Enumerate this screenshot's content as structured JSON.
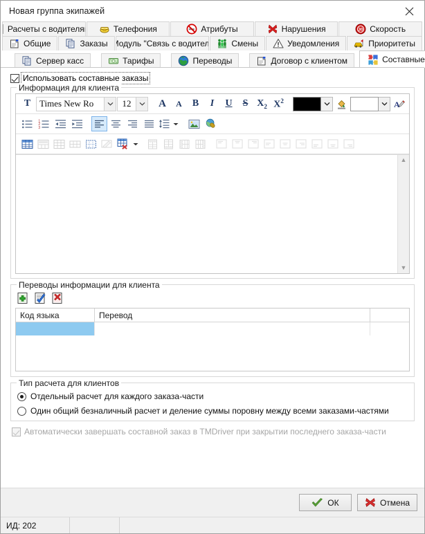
{
  "window": {
    "title": "Новая группа экипажей",
    "close_icon": "close-icon"
  },
  "tabs": {
    "row1": [
      {
        "label": "Расчеты с водителями",
        "icon": "calculator-icon"
      },
      {
        "label": "Телефония",
        "icon": "phone-icon"
      },
      {
        "label": "Атрибуты",
        "icon": "no-smoking-icon"
      },
      {
        "label": "Нарушения",
        "icon": "red-x-icon"
      },
      {
        "label": "Скорость",
        "icon": "speed-limit-icon"
      }
    ],
    "row2": [
      {
        "label": "Общие",
        "icon": "document-icon"
      },
      {
        "label": "Заказы",
        "icon": "copy-icon"
      },
      {
        "label": "Модуль \"Связь с водителями\"",
        "icon": "radio-icon"
      },
      {
        "label": "Смены",
        "icon": "people-icon"
      },
      {
        "label": "Уведомления",
        "icon": "warning-icon"
      },
      {
        "label": "Приоритеты",
        "icon": "taxi-icon"
      }
    ],
    "row3": [
      {
        "label": "Сервер касс",
        "icon": "copy-icon"
      },
      {
        "label": "Тарифы",
        "icon": "money-icon"
      },
      {
        "label": "Переводы",
        "icon": "globe-icon"
      },
      {
        "label": "Договор с клиентом",
        "icon": "document-icon"
      },
      {
        "label": "Составные заказы",
        "icon": "puzzle-icon",
        "active": true
      }
    ]
  },
  "main": {
    "use_composite_orders": {
      "label": "Использовать составные заказы",
      "checked": true
    },
    "client_info": {
      "legend": "Информация для клиента",
      "font_name": "Times New Ro",
      "font_size": "12",
      "text_color": "#000000",
      "highlight_color": "#ffffff",
      "content": "",
      "toolbar_row1": [
        {
          "name": "font-dialog-icon",
          "label": "T"
        },
        {
          "name": "grow-font-icon",
          "label": "A"
        },
        {
          "name": "shrink-font-icon",
          "label": "A"
        },
        {
          "name": "bold-icon",
          "label": "B"
        },
        {
          "name": "italic-icon",
          "label": "I"
        },
        {
          "name": "underline-icon",
          "label": "U"
        },
        {
          "name": "strikethrough-icon",
          "label": "S"
        },
        {
          "name": "subscript-icon",
          "label": "X₂"
        },
        {
          "name": "superscript-icon",
          "label": "X²"
        },
        {
          "name": "fill-color-icon",
          "label": ""
        },
        {
          "name": "text-highlight-icon",
          "label": "A"
        }
      ],
      "toolbar_row2": [
        {
          "name": "bullet-list-icon"
        },
        {
          "name": "numbered-list-icon"
        },
        {
          "name": "decrease-indent-icon"
        },
        {
          "name": "increase-indent-icon"
        },
        {
          "name": "align-left-icon",
          "selected": true
        },
        {
          "name": "align-center-icon"
        },
        {
          "name": "align-right-icon"
        },
        {
          "name": "align-justify-icon"
        },
        {
          "name": "line-spacing-icon"
        },
        {
          "name": "insert-image-icon"
        },
        {
          "name": "insert-hyperlink-icon"
        }
      ],
      "toolbar_row3": [
        {
          "name": "insert-table-icon",
          "dim": false
        },
        {
          "name": "merge-cells-icon",
          "dim": true
        },
        {
          "name": "split-cells-icon",
          "dim": true
        },
        {
          "name": "table-grid-icon",
          "dim": true
        },
        {
          "name": "table-borders-icon",
          "dim": false
        },
        {
          "name": "table-properties-icon",
          "dim": true
        },
        {
          "name": "delete-table-icon",
          "dim": false
        },
        {
          "name": "insert-row-above-icon",
          "dim": true
        },
        {
          "name": "insert-row-below-icon",
          "dim": true
        },
        {
          "name": "insert-column-left-icon",
          "dim": true
        },
        {
          "name": "insert-column-right-icon",
          "dim": true
        },
        {
          "name": "cell-align-top-left-icon",
          "dim": true
        },
        {
          "name": "cell-align-top-center-icon",
          "dim": true
        },
        {
          "name": "cell-align-top-right-icon",
          "dim": true
        },
        {
          "name": "cell-align-middle-left-icon",
          "dim": true
        },
        {
          "name": "cell-align-middle-center-icon",
          "dim": true
        },
        {
          "name": "cell-align-middle-right-icon",
          "dim": true
        },
        {
          "name": "cell-align-bottom-left-icon",
          "dim": true
        },
        {
          "name": "cell-align-bottom-center-icon",
          "dim": true
        },
        {
          "name": "cell-align-bottom-right-icon",
          "dim": true
        }
      ]
    },
    "translations": {
      "legend": "Переводы информации для клиента",
      "buttons": [
        {
          "name": "add-translation-button",
          "icon": "add-green-icon"
        },
        {
          "name": "edit-translation-button",
          "icon": "edit-check-icon"
        },
        {
          "name": "delete-translation-button",
          "icon": "delete-red-icon"
        }
      ],
      "columns": [
        "Код языка",
        "Перевод"
      ],
      "rows": [
        {
          "lang_code": "",
          "translation": "",
          "selected": true
        }
      ]
    },
    "calc_type": {
      "legend": "Тип расчета для клиентов",
      "options": [
        {
          "label": "Отдельный расчет для каждого заказа-части",
          "selected": true
        },
        {
          "label": "Один общий безналичный расчет и деление суммы поровну между всеми заказами-частями",
          "selected": false
        }
      ]
    },
    "auto_finish": {
      "label": "Автоматически завершать составной заказ в TMDriver при закрытии последнего заказа-части",
      "checked": true,
      "disabled": true
    }
  },
  "footer": {
    "ok_label": "ОК",
    "cancel_label": "Отмена"
  },
  "statusbar": {
    "id_label": "ИД: 202",
    "seg2": "",
    "seg3": ""
  }
}
